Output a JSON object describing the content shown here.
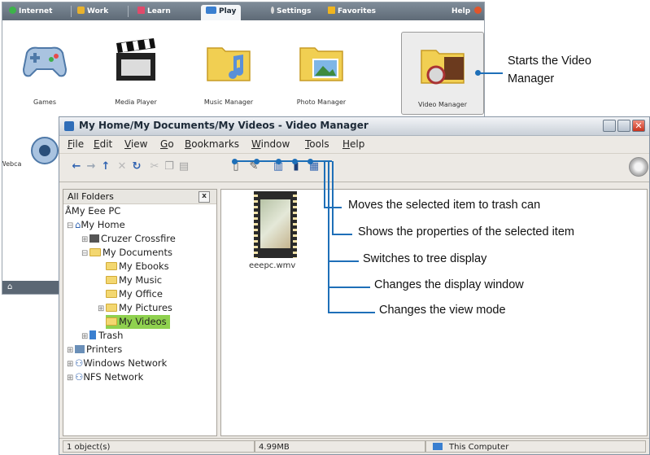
{
  "launcher": {
    "tabs": [
      {
        "label": "Internet",
        "icon": "globe-icon",
        "color": "#3db34a"
      },
      {
        "label": "Work",
        "icon": "briefcase-icon",
        "color": "#e8b22d"
      },
      {
        "label": "Learn",
        "icon": "book-icon",
        "color": "#e04a6b"
      },
      {
        "label": "Play",
        "icon": "gamepad-icon",
        "color": "#3a7fd0"
      },
      {
        "label": "Settings",
        "icon": "wrench-icon",
        "color": "#d9d9d9"
      },
      {
        "label": "Favorites",
        "icon": "star-icon",
        "color": "#f0b51f"
      },
      {
        "label": "Help",
        "icon": "help-icon",
        "color": "#e0552b"
      }
    ],
    "active_tab": "Play",
    "apps": [
      {
        "label": "Games",
        "icon": "gamepad-icon"
      },
      {
        "label": "Media Player",
        "icon": "clapperboard-icon"
      },
      {
        "label": "Music Manager",
        "icon": "music-folder-icon"
      },
      {
        "label": "Photo Manager",
        "icon": "photo-folder-icon"
      },
      {
        "label": "Video Manager",
        "icon": "video-folder-icon"
      }
    ],
    "partial_app_label": "Webca"
  },
  "video_manager": {
    "title": "My Home/My Documents/My Videos - Video Manager",
    "menus": [
      "File",
      "Edit",
      "View",
      "Go",
      "Bookmarks",
      "Window",
      "Tools",
      "Help"
    ],
    "menu_underlines": [
      "F",
      "E",
      "V",
      "G",
      "B",
      "W",
      "T",
      "H"
    ],
    "sidebar": {
      "title": "All Folders",
      "close_glyph": "x",
      "tree": [
        {
          "label": "My Eee PC",
          "icon": "eeepc-icon"
        },
        {
          "label": "My Home",
          "icon": "home-icon"
        },
        {
          "label": "Cruzer Crossfire",
          "icon": "usb-drive-icon"
        },
        {
          "label": "My Documents",
          "icon": "folder-icon"
        },
        {
          "label": "My Ebooks",
          "icon": "folder-icon"
        },
        {
          "label": "My Music",
          "icon": "folder-icon"
        },
        {
          "label": "My Office",
          "icon": "folder-icon"
        },
        {
          "label": "My Pictures",
          "icon": "folder-icon"
        },
        {
          "label": "My Videos",
          "icon": "folder-icon",
          "selected": true
        },
        {
          "label": "Trash",
          "icon": "trash-icon"
        },
        {
          "label": "Printers",
          "icon": "printer-icon"
        },
        {
          "label": "Windows Network",
          "icon": "network-icon"
        },
        {
          "label": "NFS Network",
          "icon": "network-icon"
        }
      ]
    },
    "files": [
      {
        "name": "eeepc.wmv",
        "icon": "video-file-icon"
      }
    ],
    "status": {
      "objects": "1 object(s)",
      "size": "4.99MB",
      "location": "This Computer"
    }
  },
  "callouts": {
    "video_manager": "Starts the Video\nManager",
    "trash": "Moves the selected item to trash can",
    "properties": "Shows the properties of the selected item",
    "tree": "Switches to tree display",
    "display_window": "Changes the display window",
    "view_mode": "Changes the view mode"
  },
  "colors": {
    "callout_line": "#1e6fb8",
    "selected_folder": "#8fd14f",
    "launcher_tab_bar": "#5e6a76"
  }
}
